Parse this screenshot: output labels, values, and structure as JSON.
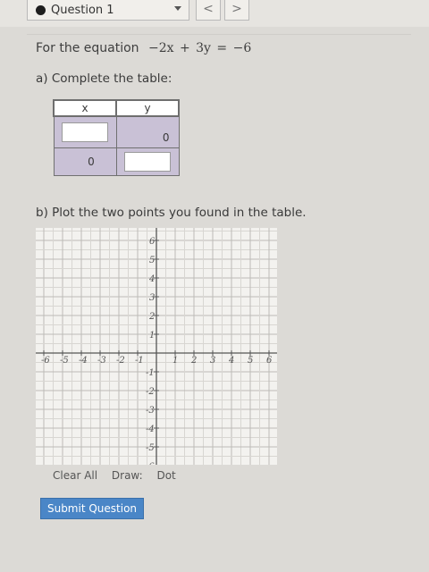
{
  "header": {
    "question_label": "Question 1",
    "prev_glyph": "<",
    "next_glyph": ">"
  },
  "problem": {
    "intro": "For the equation",
    "equation": "−2x + 3y = −6"
  },
  "part_a": {
    "label": "a) Complete the table:",
    "columns": [
      "x",
      "y"
    ],
    "rows": [
      {
        "x": "",
        "y": "0"
      },
      {
        "x": "0",
        "y": ""
      }
    ]
  },
  "part_b": {
    "label": "b) Plot the two points you found in the table."
  },
  "graph": {
    "x_range": [
      -6,
      6
    ],
    "y_range": [
      -6,
      6
    ],
    "x_ticks": [
      "-6",
      "-5",
      "-4",
      "-3",
      "-2",
      "-1",
      "1",
      "2",
      "3",
      "4",
      "5",
      "6"
    ],
    "y_ticks": [
      "6",
      "5",
      "4",
      "3",
      "2",
      "1",
      "-1",
      "-2",
      "-3",
      "-4",
      "-5",
      "-6"
    ],
    "grid": true
  },
  "tools": {
    "clear_all": "Clear All",
    "draw_label": "Draw:",
    "dot": "Dot"
  },
  "submit_label": "Submit Question",
  "colors": {
    "table_cell": "#c9c1d6",
    "submit_button": "#4a86c7",
    "background": "#dcdad6"
  }
}
